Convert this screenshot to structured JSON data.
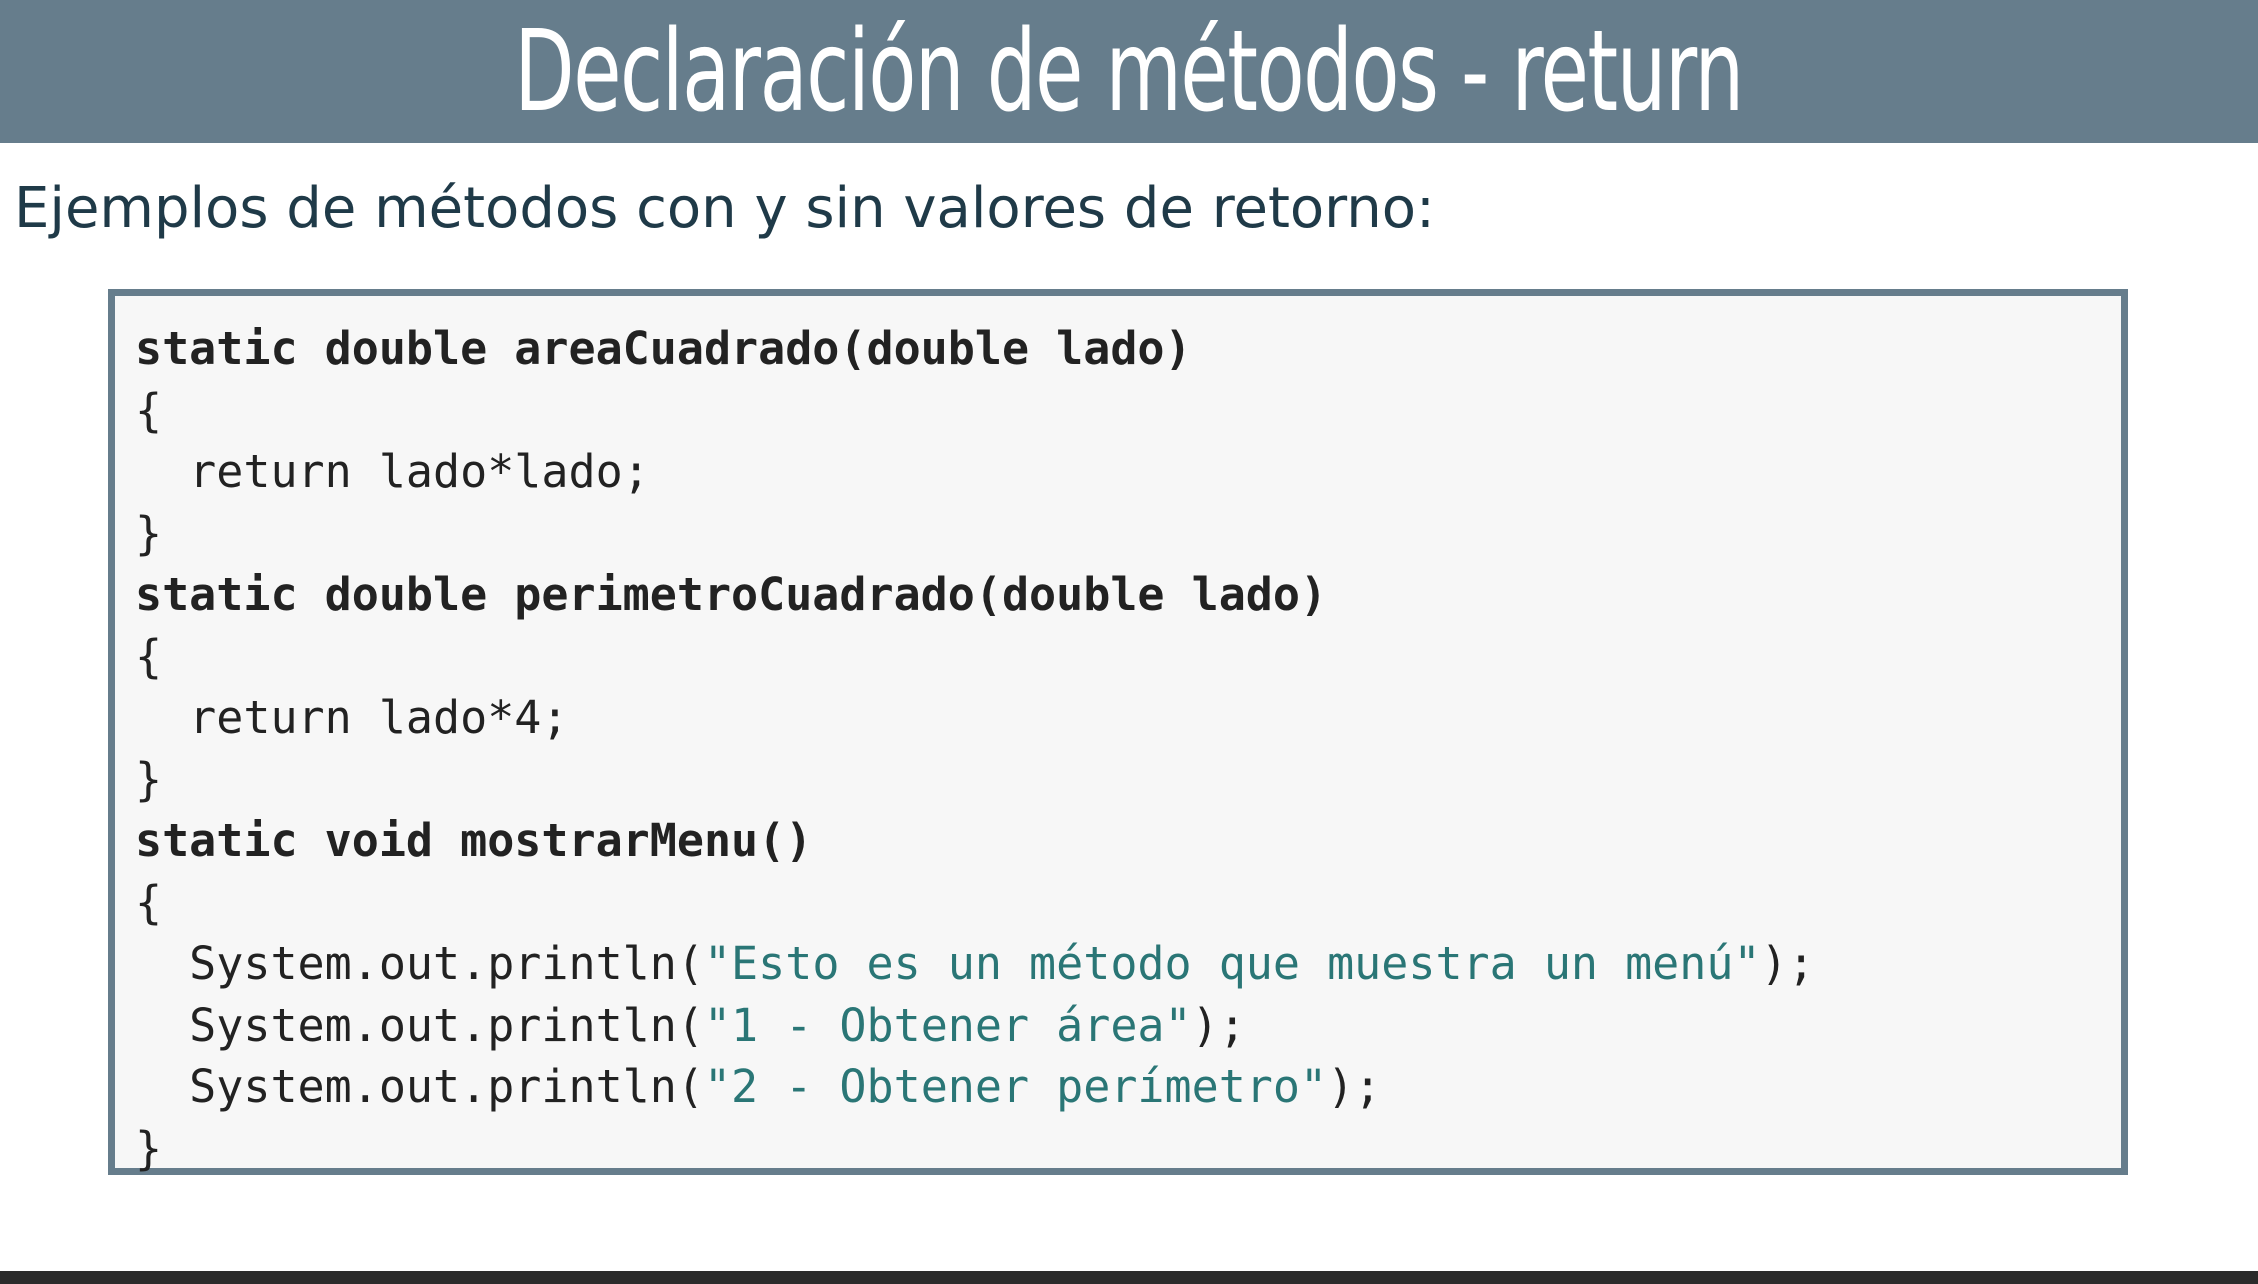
{
  "slide": {
    "title": "Declaración de métodos - return",
    "subtitle": "Ejemplos de métodos con y sin valores de retorno:"
  },
  "code": {
    "lines": [
      {
        "parts": [
          {
            "text": "static double areaCuadrado(double lado)",
            "kind": "plain"
          }
        ],
        "bold": true
      },
      {
        "parts": [
          {
            "text": "{",
            "kind": "plain"
          }
        ],
        "bold": false
      },
      {
        "parts": [
          {
            "text": "  return lado*lado;",
            "kind": "plain"
          }
        ],
        "bold": false
      },
      {
        "parts": [
          {
            "text": "}",
            "kind": "plain"
          }
        ],
        "bold": false
      },
      {
        "parts": [
          {
            "text": "static double perimetroCuadrado(double lado)",
            "kind": "plain"
          }
        ],
        "bold": true
      },
      {
        "parts": [
          {
            "text": "{",
            "kind": "plain"
          }
        ],
        "bold": false
      },
      {
        "parts": [
          {
            "text": "  return lado*4;",
            "kind": "plain"
          }
        ],
        "bold": false
      },
      {
        "parts": [
          {
            "text": "}",
            "kind": "plain"
          }
        ],
        "bold": false
      },
      {
        "parts": [
          {
            "text": "static void mostrarMenu()",
            "kind": "plain"
          }
        ],
        "bold": true
      },
      {
        "parts": [
          {
            "text": "{",
            "kind": "plain"
          }
        ],
        "bold": false
      },
      {
        "parts": [
          {
            "text": "  System.out.println(",
            "kind": "plain"
          },
          {
            "text": "\"Esto es un método que muestra un menú\"",
            "kind": "string"
          },
          {
            "text": ");",
            "kind": "plain"
          }
        ],
        "bold": false
      },
      {
        "parts": [
          {
            "text": "  System.out.println(",
            "kind": "plain"
          },
          {
            "text": "\"1 - Obtener área\"",
            "kind": "string"
          },
          {
            "text": ");",
            "kind": "plain"
          }
        ],
        "bold": false
      },
      {
        "parts": [
          {
            "text": "  System.out.println(",
            "kind": "plain"
          },
          {
            "text": "\"2 - Obtener perímetro\"",
            "kind": "string"
          },
          {
            "text": ");",
            "kind": "plain"
          }
        ],
        "bold": false
      },
      {
        "parts": [
          {
            "text": "}",
            "kind": "plain"
          }
        ],
        "bold": false
      }
    ]
  },
  "colors": {
    "title_bar": "#667d8c",
    "title_text": "#ffffff",
    "subtitle_text": "#1f3a48",
    "code_background": "#f7f7f7",
    "code_border": "#667d8c",
    "code_text": "#222222",
    "string_literal": "#2a7676",
    "footer_bar": "#2b2b2b"
  }
}
